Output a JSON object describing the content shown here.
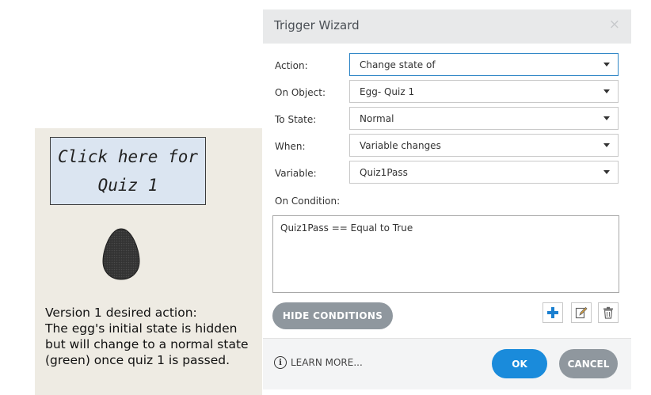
{
  "slide": {
    "quiz_button": {
      "line1": "Click here for",
      "line2": "Quiz 1"
    },
    "description": [
      "Version 1 desired action:",
      "The egg's initial state is hidden",
      "but will change to a normal state",
      "(green) once quiz 1 is passed."
    ]
  },
  "dialog": {
    "title": "Trigger Wizard",
    "close_glyph": "×",
    "fields": {
      "action": {
        "label": "Action:",
        "value": "Change state of"
      },
      "on_object": {
        "label": "On Object:",
        "value": "Egg- Quiz 1"
      },
      "to_state": {
        "label": "To State:",
        "value": "Normal"
      },
      "when": {
        "label": "When:",
        "value": "Variable changes"
      },
      "variable": {
        "label": "Variable:",
        "value": "Quiz1Pass"
      }
    },
    "on_condition_label": "On Condition:",
    "condition_text": "Quiz1Pass == Equal to True",
    "hide_conditions_label": "HIDE CONDITIONS",
    "icons": {
      "add": "plus-icon",
      "edit": "edit-icon",
      "delete": "trash-icon"
    },
    "learn_more_label": "LEARN MORE...",
    "ok_label": "OK",
    "cancel_label": "CANCEL"
  },
  "colors": {
    "accent_blue": "#1a8bdb",
    "gray_button": "#8f979e",
    "slide_bg": "#eeebe3",
    "quiz_button_bg": "#dbe5f1"
  }
}
